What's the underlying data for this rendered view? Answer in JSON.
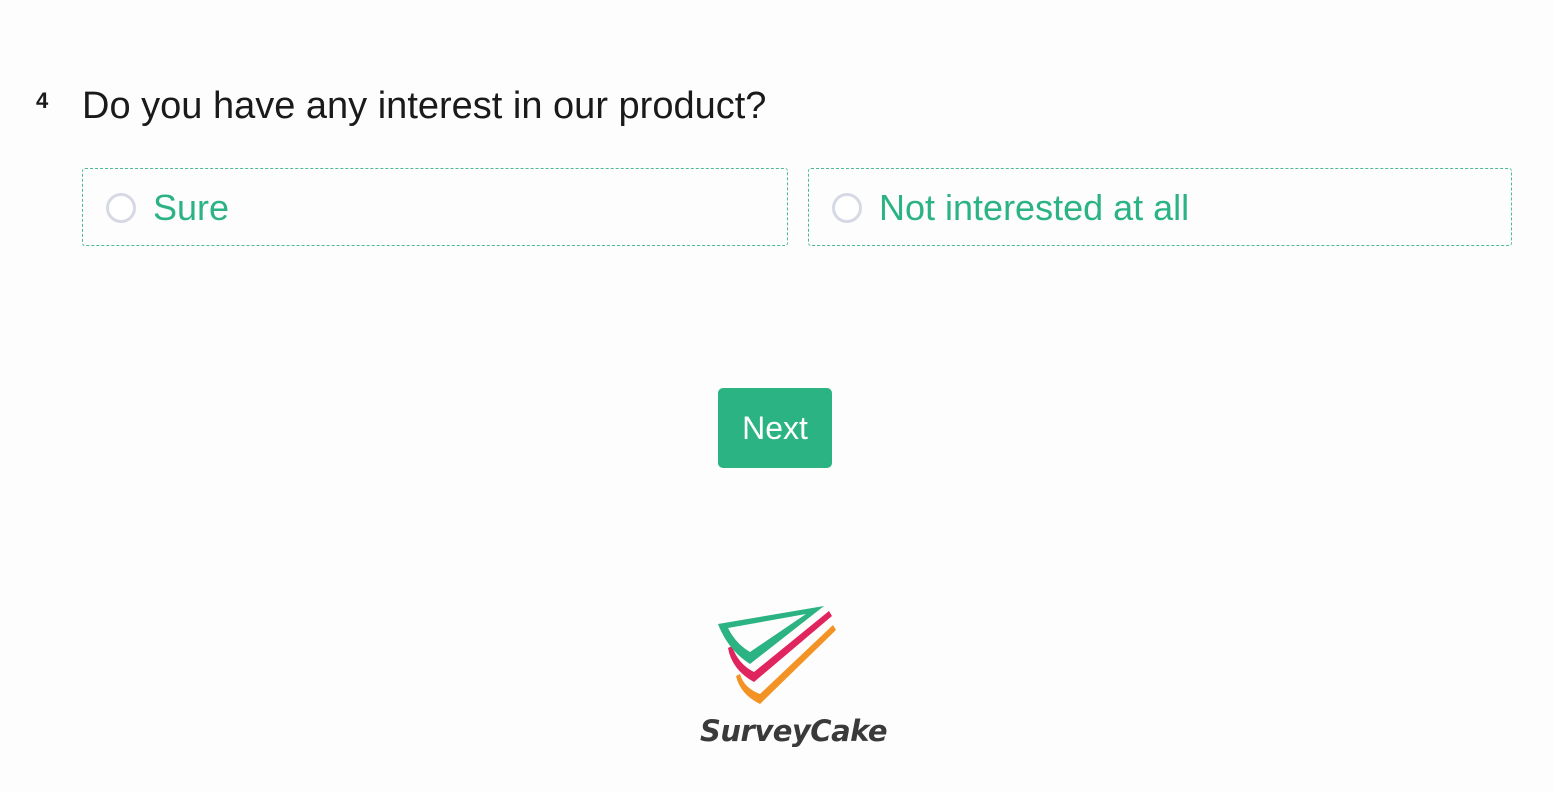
{
  "question": {
    "number": "4",
    "title": "Do you have any interest in our product?"
  },
  "options": [
    {
      "label": "Sure",
      "selected": false
    },
    {
      "label": "Not interested at all",
      "selected": false
    }
  ],
  "next_button": {
    "label": "Next"
  },
  "brand": {
    "name": "SurveyCake",
    "colors": {
      "accent": "#2bb383",
      "logo_green": "#2bb383",
      "logo_red": "#e0245e",
      "logo_orange": "#f39325"
    }
  }
}
